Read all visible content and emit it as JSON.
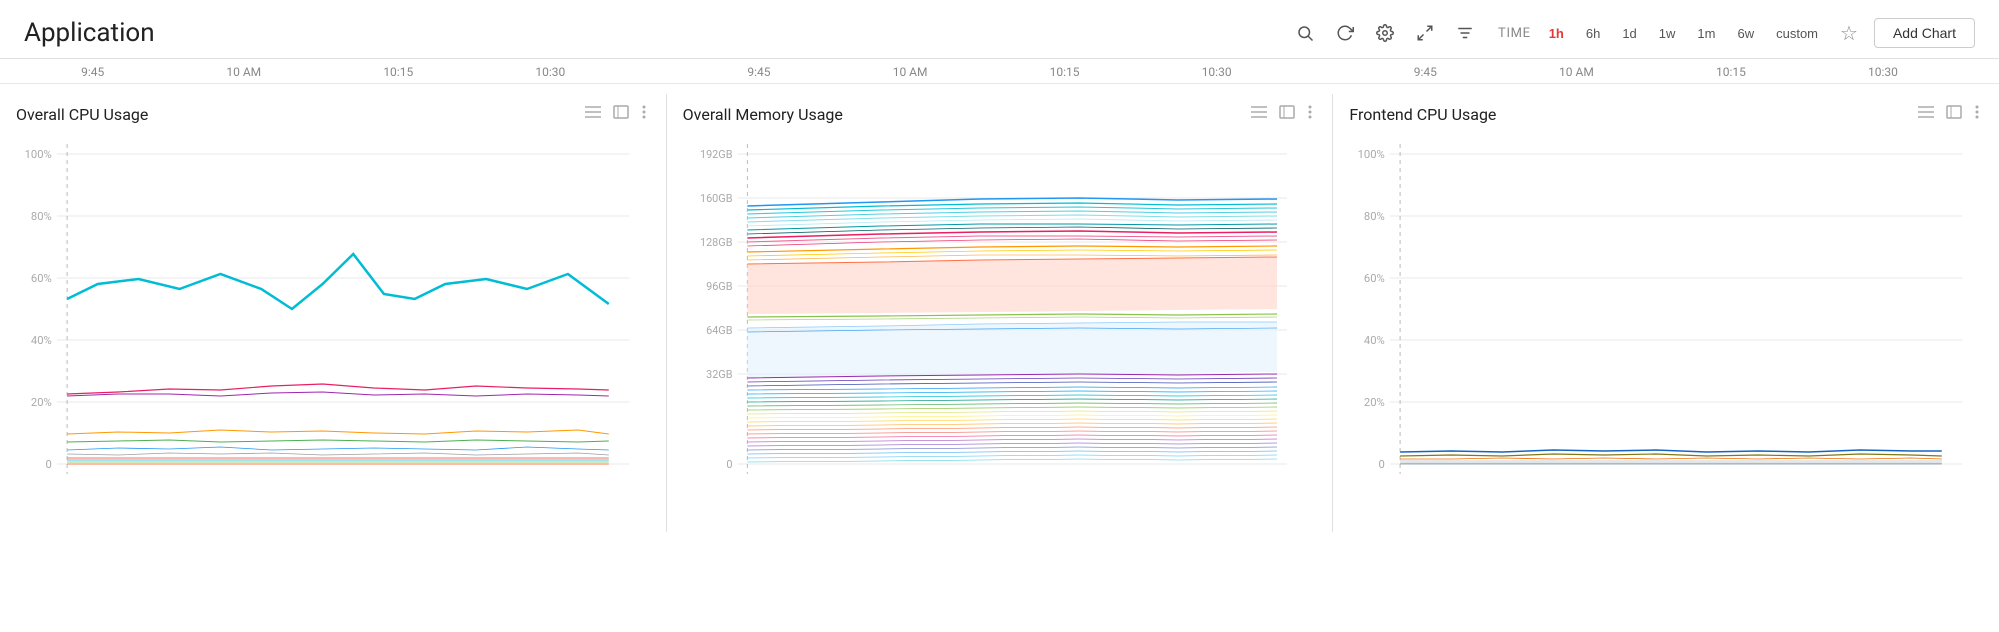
{
  "header": {
    "title": "Application",
    "controls": {
      "search_icon": "🔍",
      "refresh_icon": "↻",
      "settings_icon": "⚙",
      "fullscreen_icon": "⤢",
      "filter_icon": "≡",
      "time_label": "TIME",
      "time_options": [
        "1h",
        "6h",
        "1d",
        "1w",
        "1m",
        "6w",
        "custom"
      ],
      "active_time": "1h",
      "star_label": "☆",
      "add_chart_label": "Add Chart"
    }
  },
  "time_axes": [
    [
      "9:45",
      "10 AM",
      "10:15",
      "10:30"
    ],
    [
      "9:45",
      "10 AM",
      "10:15",
      "10:30"
    ],
    [
      "9:45",
      "10 AM",
      "10:15",
      "10:30"
    ]
  ],
  "charts": [
    {
      "title": "Overall CPU Usage",
      "y_labels": [
        "100%",
        "80%",
        "60%",
        "40%",
        "20%",
        "0"
      ],
      "type": "cpu_overall"
    },
    {
      "title": "Overall Memory Usage",
      "y_labels": [
        "192GB",
        "160GB",
        "128GB",
        "96GB",
        "64GB",
        "32GB",
        "0"
      ],
      "type": "memory_overall"
    },
    {
      "title": "Frontend CPU Usage",
      "y_labels": [
        "100%",
        "80%",
        "60%",
        "40%",
        "20%",
        "0"
      ],
      "type": "cpu_frontend"
    }
  ],
  "icons": {
    "hamburger": "≡",
    "expand": "⤢",
    "dots": "⋮",
    "search": "⌕",
    "refresh": "⟳",
    "gear": "⚙",
    "fullscreen": "⤢",
    "filter": "⊟"
  }
}
